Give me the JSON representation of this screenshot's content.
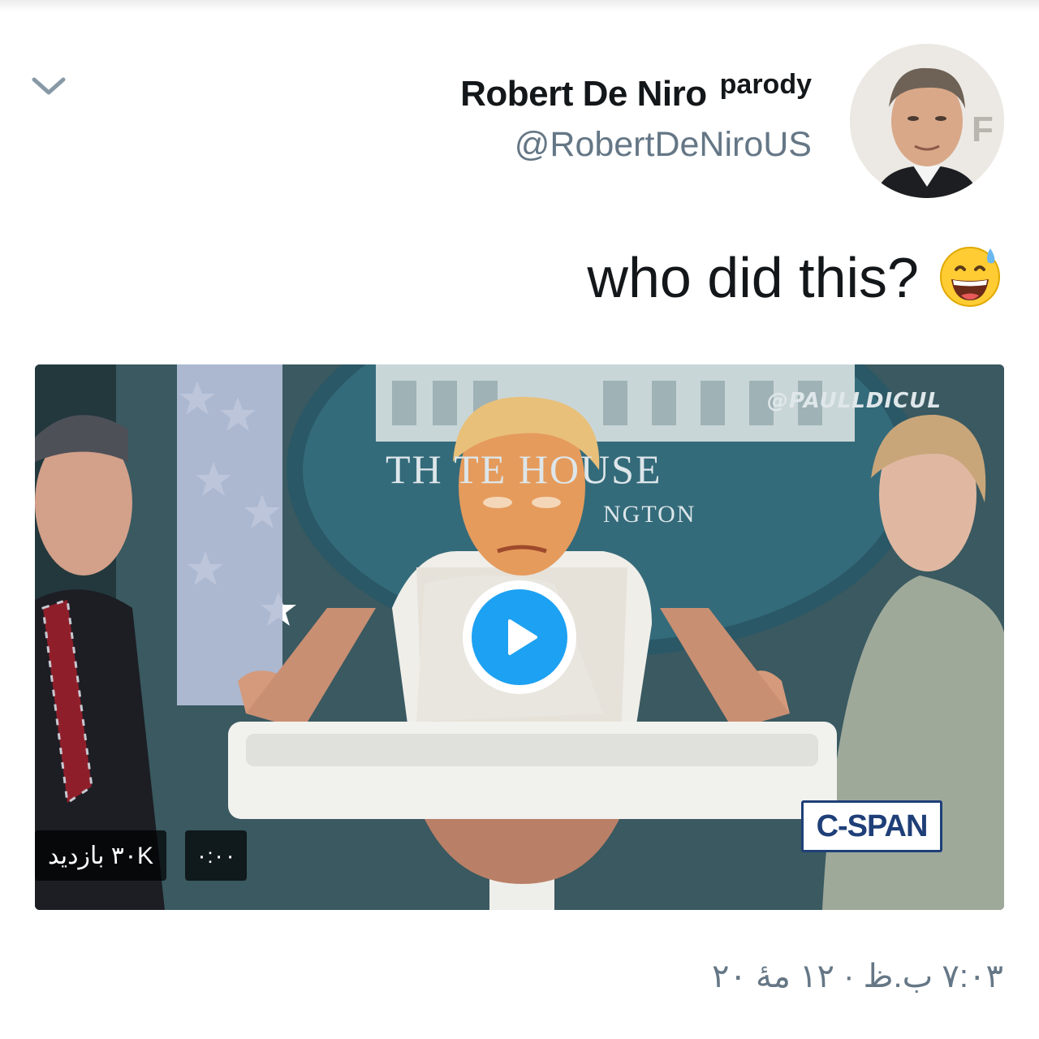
{
  "tweet": {
    "display_name": "Robert De Niro",
    "name_suffix": "parody",
    "handle": "@RobertDeNiroUS",
    "text": "who did this?",
    "emoji": "😅",
    "timestamp": "۷:۰۳ ب.ظ · ۱۲ مهٔ ۲۰"
  },
  "media": {
    "watermark": "@PAULLDICUL",
    "sign_line1": "TH        TE HOUSE",
    "sign_line2": "NGTON",
    "broadcaster": "C-SPAN",
    "views_label": "۳۰K بازدید",
    "duration": "۰:۰۰"
  },
  "icons": {
    "menu": "chevron-down-icon",
    "play": "play-icon",
    "avatar": "avatar"
  },
  "colors": {
    "accent": "#1da1f2",
    "text_primary": "#14171a",
    "text_secondary": "#657786"
  }
}
